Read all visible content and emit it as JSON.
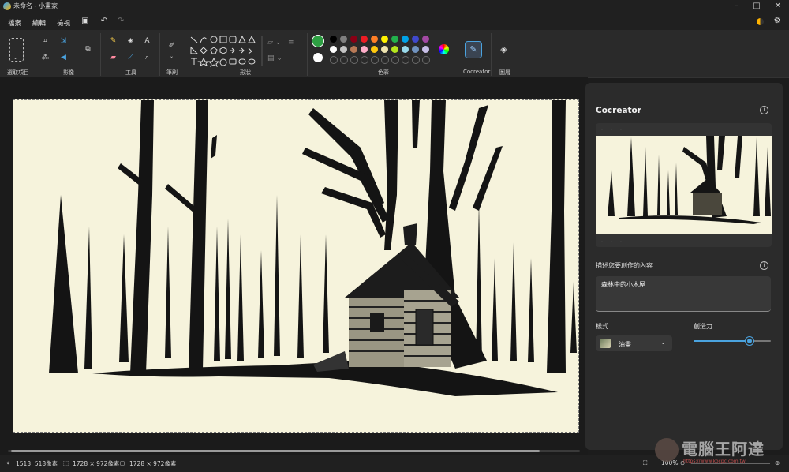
{
  "window": {
    "title": "未命名 - 小畫家"
  },
  "menu": {
    "file": "檔案",
    "edit": "編輯",
    "view": "檢視"
  },
  "ribbon": {
    "groups": {
      "selection": "選取項目",
      "image": "影像",
      "tools": "工具",
      "brushes": "筆刷",
      "shapes": "形狀",
      "colors": "色彩",
      "cocreator": "Cocreator",
      "layers": "圖層"
    },
    "colors": {
      "primary": "#2ea043",
      "secondary": "#ffffff",
      "row1": [
        "#000000",
        "#7f7f7f",
        "#880015",
        "#ed1c24",
        "#ff7f27",
        "#fff200",
        "#22b14c",
        "#00a2e8",
        "#3f48cc",
        "#a349a4"
      ],
      "row2": [
        "#ffffff",
        "#c3c3c3",
        "#b97a57",
        "#ffaec9",
        "#ffc90e",
        "#efe4b0",
        "#b5e61d",
        "#99d9ea",
        "#7092be",
        "#c8bfe7"
      ]
    },
    "tool_glyph": "A"
  },
  "panel": {
    "title": "Cocreator",
    "prompt_label": "描述您要創作的內容",
    "prompt_value": "森林中的小木屋",
    "style_label": "樣式",
    "style_value": "油畫",
    "creativity_label": "創造力",
    "creativity_level": 0.72
  },
  "status": {
    "cursor": "1513, 518像素",
    "selection": "1728 × 972像素",
    "canvas_size": "1728 × 972像素",
    "zoom": "100%"
  },
  "watermark": {
    "text": "電腦王阿達",
    "url": "https://www.kocpc.com.tw"
  }
}
